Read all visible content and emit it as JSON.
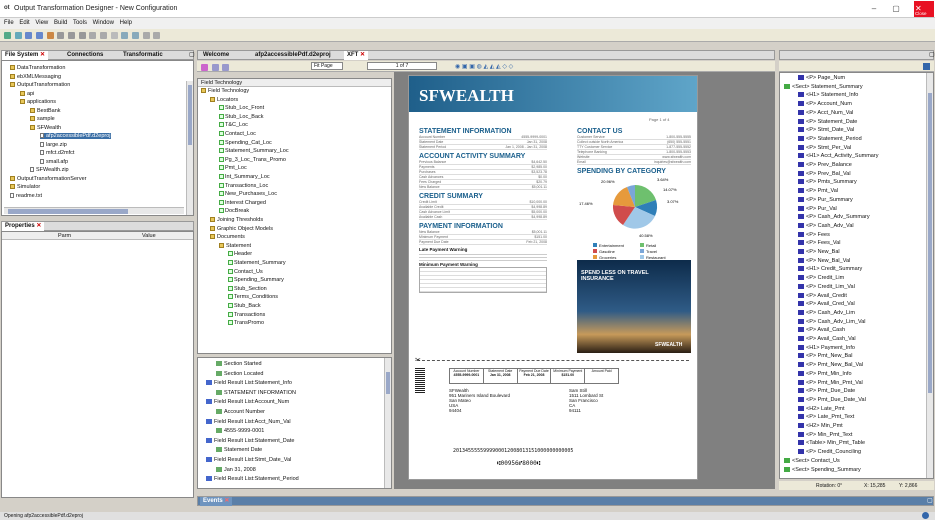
{
  "app": {
    "title": "Output Transformation Designer - New Configuration",
    "close_label": "Close"
  },
  "menu": [
    "File",
    "Edit",
    "View",
    "Build",
    "Tools",
    "Window",
    "Help"
  ],
  "left_tabs": {
    "file_system": "File System",
    "connections": "Connections",
    "transformatic": "Transformatic"
  },
  "file_tree": [
    {
      "label": "DataTransformation",
      "indent": 0,
      "kind": "folder"
    },
    {
      "label": "ebXMLMessaging",
      "indent": 0,
      "kind": "folder"
    },
    {
      "label": "OutputTransformation",
      "indent": 0,
      "kind": "folder"
    },
    {
      "label": "api",
      "indent": 1,
      "kind": "folder"
    },
    {
      "label": "applications",
      "indent": 1,
      "kind": "folder"
    },
    {
      "label": "BestBank",
      "indent": 2,
      "kind": "folder"
    },
    {
      "label": "sample",
      "indent": 2,
      "kind": "folder"
    },
    {
      "label": "SFWealth",
      "indent": 2,
      "kind": "folder"
    },
    {
      "label": "afp2accessiblePdf.d2eproj",
      "indent": 3,
      "kind": "doc",
      "selected": true
    },
    {
      "label": "large.zip",
      "indent": 3,
      "kind": "doc"
    },
    {
      "label": "mfct.d2mfct",
      "indent": 3,
      "kind": "doc"
    },
    {
      "label": "small.afp",
      "indent": 3,
      "kind": "doc"
    },
    {
      "label": "SFWealth.zip",
      "indent": 2,
      "kind": "doc"
    },
    {
      "label": "OutputTransformationServer",
      "indent": 0,
      "kind": "folder"
    },
    {
      "label": "Simulator",
      "indent": 0,
      "kind": "folder"
    },
    {
      "label": "readme.txt",
      "indent": 0,
      "kind": "doc"
    }
  ],
  "properties": {
    "title": "Properties",
    "col1": "Parm",
    "col2": "Value"
  },
  "center_tabs": {
    "welcome": "Welcome",
    "proj": "afp2accessiblePdf.d2eproj",
    "xft": "XFT"
  },
  "field_tech": {
    "header": "Field Technology",
    "rows": [
      {
        "label": "Field Technology",
        "indent": 0,
        "kind": "folder"
      },
      {
        "label": "Locators",
        "indent": 1,
        "kind": "folder"
      },
      {
        "label": "Stub_Loc_Front",
        "indent": 2,
        "kind": "chk"
      },
      {
        "label": "Stub_Loc_Back",
        "indent": 2,
        "kind": "chk"
      },
      {
        "label": "T&C_Loc",
        "indent": 2,
        "kind": "chk"
      },
      {
        "label": "Contact_Loc",
        "indent": 2,
        "kind": "chk"
      },
      {
        "label": "Spending_Cat_Loc",
        "indent": 2,
        "kind": "chk"
      },
      {
        "label": "Statement_Summary_Loc",
        "indent": 2,
        "kind": "chk"
      },
      {
        "label": "Pg_3_Loc_Trans_Promo",
        "indent": 2,
        "kind": "chk"
      },
      {
        "label": "Pmt_Loc",
        "indent": 2,
        "kind": "chk"
      },
      {
        "label": "Int_Summary_Loc",
        "indent": 2,
        "kind": "chk"
      },
      {
        "label": "Transactions_Loc",
        "indent": 2,
        "kind": "chk"
      },
      {
        "label": "New_Purchases_Loc",
        "indent": 2,
        "kind": "chk"
      },
      {
        "label": "Interest Charged",
        "indent": 2,
        "kind": "chk"
      },
      {
        "label": "DocBreak",
        "indent": 2,
        "kind": "chk"
      },
      {
        "label": "Joining Thresholds",
        "indent": 1,
        "kind": "folder"
      },
      {
        "label": "Graphic Object Models",
        "indent": 1,
        "kind": "folder"
      },
      {
        "label": "Documents",
        "indent": 1,
        "kind": "folder"
      },
      {
        "label": "Statement",
        "indent": 2,
        "kind": "folder"
      },
      {
        "label": "Header",
        "indent": 3,
        "kind": "chk"
      },
      {
        "label": "Statement_Summary",
        "indent": 3,
        "kind": "chk"
      },
      {
        "label": "Contact_Us",
        "indent": 3,
        "kind": "chk"
      },
      {
        "label": "Spending_Summary",
        "indent": 3,
        "kind": "chk"
      },
      {
        "label": "Stub_Section",
        "indent": 3,
        "kind": "chk"
      },
      {
        "label": "Terms_Conditions",
        "indent": 3,
        "kind": "chk"
      },
      {
        "label": "Stub_Back",
        "indent": 3,
        "kind": "chk"
      },
      {
        "label": "Transactions",
        "indent": 3,
        "kind": "chk"
      },
      {
        "label": "TransPromo",
        "indent": 3,
        "kind": "chk"
      }
    ]
  },
  "results": [
    {
      "label": "Section Started",
      "indent": 1
    },
    {
      "label": "Section Located",
      "indent": 1
    },
    {
      "label": "Field Result List:Statement_Info",
      "indent": 0
    },
    {
      "label": "STATEMENT INFORMATION",
      "indent": 1
    },
    {
      "label": "Field Result List:Account_Num",
      "indent": 0
    },
    {
      "label": "Account Number",
      "indent": 1
    },
    {
      "label": "Field Result List:Acct_Num_Val",
      "indent": 0
    },
    {
      "label": "4555-9999-0001",
      "indent": 1
    },
    {
      "label": "Field Result List:Statement_Date",
      "indent": 0
    },
    {
      "label": "Statement Date",
      "indent": 1
    },
    {
      "label": "Field Result List:Stmt_Date_Val",
      "indent": 0
    },
    {
      "label": "Jan 31, 2008",
      "indent": 1
    },
    {
      "label": "Field Result List:Statement_Period",
      "indent": 0
    }
  ],
  "viewer": {
    "fit": "Fit Page",
    "page": "1 of 7"
  },
  "statement": {
    "brand": "SFWEALTH",
    "page_label": "Page 1 of 4",
    "statement_info": "STATEMENT INFORMATION",
    "stmt_rows": [
      [
        "Account Number",
        "4555-9999-0001"
      ],
      [
        "Statement Date",
        "Jan 31, 2008"
      ],
      [
        "Statement Period",
        "Jan 1, 2008 - Jan 31, 2008"
      ]
    ],
    "activity": "ACCOUNT ACTIVITY SUMMARY",
    "activity_rows": [
      [
        "Previous Balance",
        "$4,642.50"
      ],
      [
        "Payments",
        "$2,985.00"
      ],
      [
        "Purchases",
        "$3,523.78"
      ],
      [
        "Cash Advances",
        "$0.00"
      ],
      [
        "Fees Charged",
        "$20.79"
      ],
      [
        "New Balance",
        "$5,001.11"
      ]
    ],
    "credit": "CREDIT SUMMARY",
    "credit_rows": [
      [
        "Credit Limit",
        "$10,000.00"
      ],
      [
        "Available Credit",
        "$4,998.89"
      ],
      [
        "Cash Advance Limit",
        "$5,000.00"
      ],
      [
        "Available Cash",
        "$4,998.89"
      ]
    ],
    "payment": "PAYMENT INFORMATION",
    "payment_rows": [
      [
        "New Balance",
        "$5,001.11"
      ],
      [
        "Minimum Payment",
        "$151.00"
      ],
      [
        "Payment Due Date",
        "Feb 21, 2008"
      ]
    ],
    "late_warning": "Late Payment Warning",
    "min_warning": "Minimum Payment Warning",
    "contact": "CONTACT US",
    "contact_rows": [
      [
        "Customer Service",
        "1-800-555-5555"
      ],
      [
        "Collect outside North America",
        "(650) 555-5551"
      ],
      [
        "TTY Customer Service",
        "1-877-555-5552"
      ],
      [
        "Telephone Banking",
        "1-800-555-5553"
      ],
      [
        "Website",
        "www.sfwealth.com"
      ],
      [
        "Email",
        "inquiries@sfwealth.com"
      ]
    ],
    "spending": "SPENDING BY CATEGORY",
    "legend": [
      "Entertainment",
      "Retail",
      "Gasoline",
      "Travel",
      "Groceries",
      "Restaurant"
    ],
    "pie_labels": [
      "20.96%",
      "3.64%",
      "14.07%",
      "3.07%",
      "17.46%",
      "40.58%"
    ],
    "promo_title": "SPEND LESS ON TRAVEL INSURANCE",
    "promo_brand": "SFWEALTH",
    "stub_head": [
      "Account Number",
      "Payment Due Date",
      "Minimum Payment",
      "Amount Paid"
    ],
    "stub_vals": [
      "4555-9999-0001",
      "Feb 21, 2008",
      "$151.00",
      ""
    ],
    "stub_date_head": "Statement Date",
    "stub_date_val": "Jan 31, 2008",
    "addr_from": [
      "SFWealth",
      "951 Mariners Island Boulevard",
      "San Mateo",
      "USA",
      "94404"
    ],
    "addr_to": [
      "Sam Still",
      "1511 Lombard St",
      "San Francisco",
      "CA",
      "94111"
    ],
    "micr1": "2013455555999900012008013151000000000005",
    "micr2": "⑆00956⑈8000⑆"
  },
  "outline": [
    "<P> Page_Num",
    "<Sect> Statement_Summary",
    "<H1> Statement_Info",
    "<P> Account_Num",
    "<P> Acct_Num_Val",
    "<P> Statement_Date",
    "<P> Stmt_Date_Val",
    "<P> Statement_Period",
    "<P> Stmt_Per_Val",
    "<H1> Acct_Activity_Summary",
    "<P> Prev_Balance",
    "<P> Prev_Bal_Val",
    "<P> Pmts_Summary",
    "<P> Pmt_Val",
    "<P> Pur_Summary",
    "<P> Pur_Val",
    "<P> Cash_Adv_Summary",
    "<P> Cash_Adv_Val",
    "<P> Fees",
    "<P> Fees_Val",
    "<P> New_Bal",
    "<P> New_Bal_Val",
    "<H1> Credit_Summary",
    "<P> Credit_Lim",
    "<P> Credit_Lim_Val",
    "<P> Avail_Credit",
    "<P> Avail_Cred_Val",
    "<P> Cash_Adv_Lim",
    "<P> Cash_Adv_Lim_Val",
    "<P> Avail_Cash",
    "<P> Avail_Cash_Val",
    "<H1> Payment_Info",
    "<P> Pmt_New_Bal",
    "<P> Pmt_New_Bal_Val",
    "<P> Pmt_Min_Info",
    "<P> Pmt_Min_Pmt_Val",
    "<P> Pmt_Due_Date",
    "<P> Pmt_Due_Date_Val",
    "<H2> Late_Pmt",
    "<P> Late_Pmt_Text",
    "<H2> Min_Pmt",
    "<P> Min_Pmt_Text",
    "<Table> Min_Pmt_Table",
    "<P> Credit_Counciling",
    "<Sect> Contact_Us",
    "<Sect> Spending_Summary"
  ],
  "status": {
    "rotation": "Rotation: 0°",
    "x": "X: 15,285",
    "y": "Y: 2,866"
  },
  "events_tab": "Events",
  "bottom_status": "Opening afp2accessiblePdf.d2eproj"
}
